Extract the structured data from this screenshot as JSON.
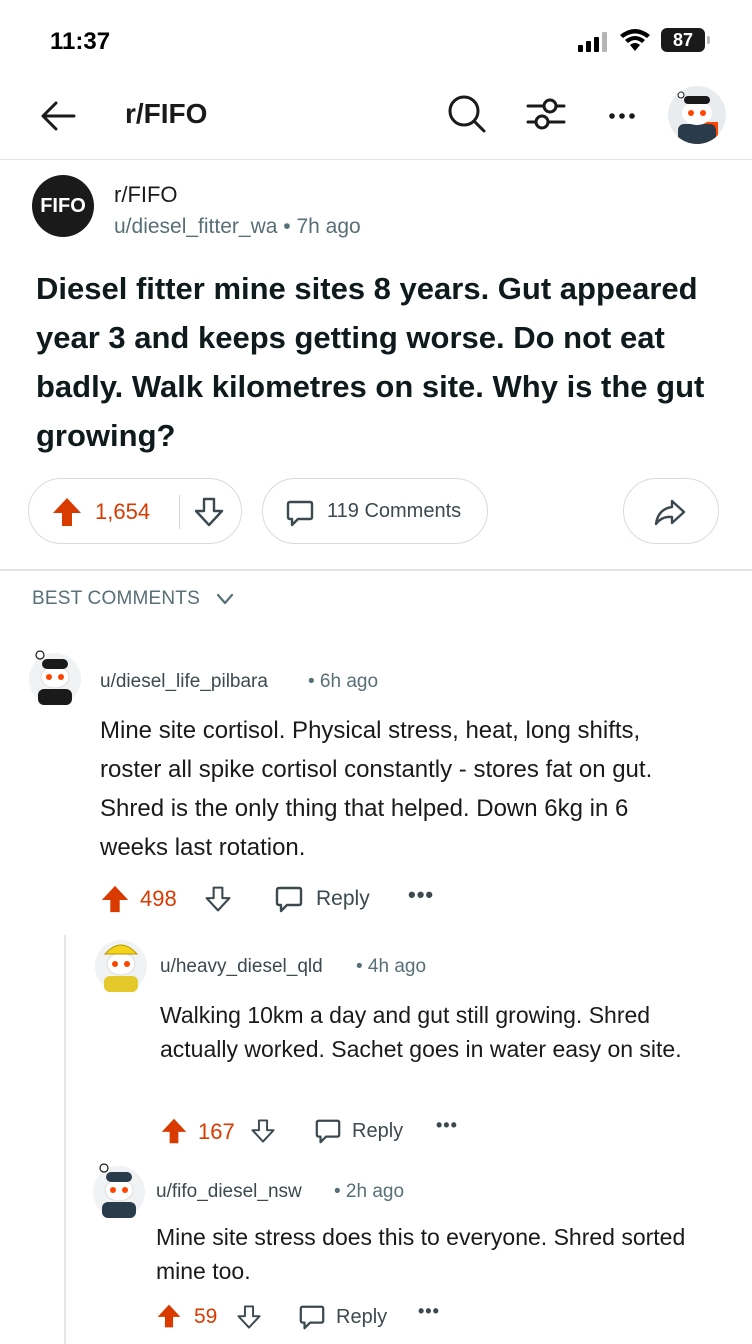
{
  "status_bar": {
    "time": "11:37",
    "battery": "87"
  },
  "header": {
    "title": "r/FIFO"
  },
  "post": {
    "subreddit_logo": "FIFO",
    "subreddit": "r/FIFO",
    "meta": "u/diesel_fitter_wa • 7h ago",
    "title": "Diesel fitter mine sites 8 years. Gut appeared year 3 and keeps getting worse. Do not eat badly. Walk kilometres on site. Why is the gut growing?",
    "votes": "1,654",
    "comments_label": "119 Comments"
  },
  "sort": {
    "label": "BEST COMMENTS"
  },
  "comments": [
    {
      "user": "u/diesel_life_pilbara",
      "time": "• 6h ago",
      "body": "Mine site cortisol. Physical stress, heat, long shifts, roster all spike cortisol constantly - stores fat on gut. Shred is the only thing that helped. Down 6kg in 6 weeks last rotation.",
      "votes": "498",
      "reply": "Reply",
      "more": "•••"
    },
    {
      "user": "u/heavy_diesel_qld",
      "time": "• 4h ago",
      "body": "Walking 10km a day and gut still growing. Shred actually worked. Sachet goes in water easy on site.",
      "votes": "167",
      "reply": "Reply",
      "more": "•••"
    },
    {
      "user": "u/fifo_diesel_nsw",
      "time": "• 2h ago",
      "body": "Mine site stress does this to everyone. Shred sorted mine too.",
      "votes": "59",
      "reply": "Reply",
      "more": "•••"
    }
  ],
  "colors": {
    "upvote": "#d93a00",
    "text": "#1a1a1b",
    "meta": "#576f76"
  }
}
